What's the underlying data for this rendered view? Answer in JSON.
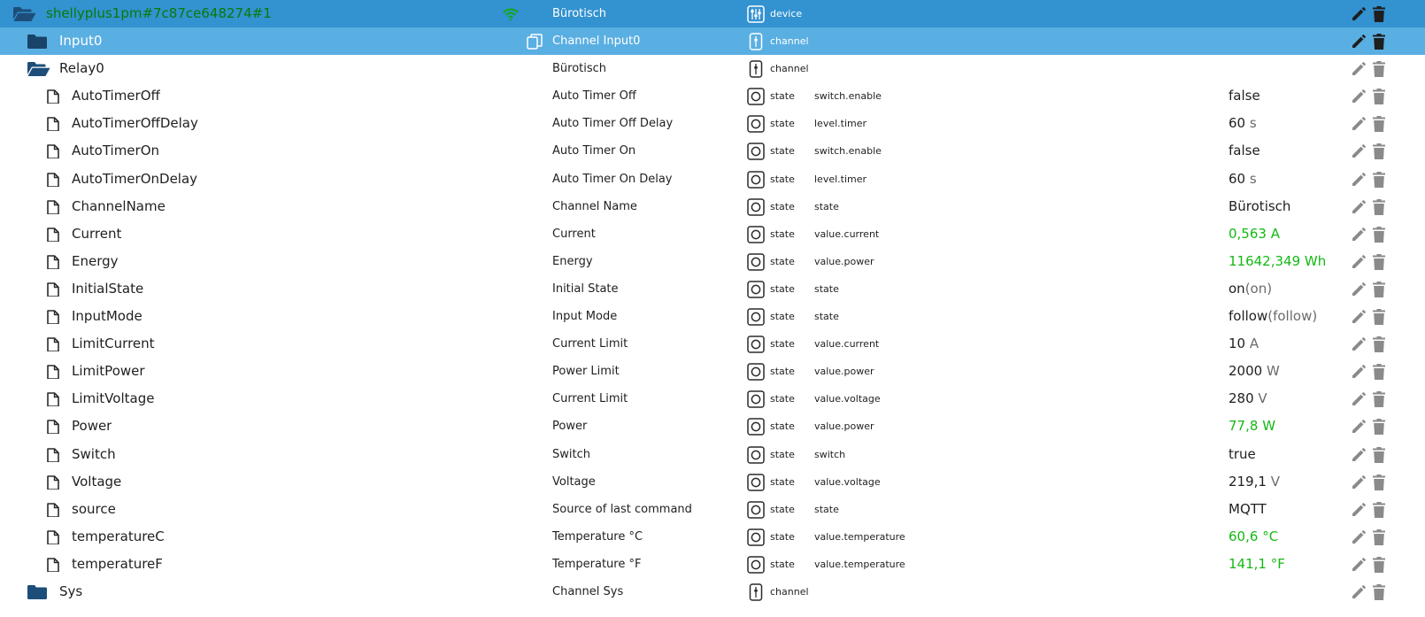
{
  "rows": [
    {
      "name": "shellyplus1pm#7c87ce648274#1",
      "level": 0,
      "icon": "folder-open-icon",
      "label": "Bürotisch",
      "type": "device",
      "role": "",
      "value": "",
      "unit": "",
      "value_extra": "",
      "value_color": "",
      "selected": 1,
      "wifi_icon": "wifi-icon"
    },
    {
      "name": "Input0",
      "level": 1,
      "icon": "folder-icon",
      "label": "Channel Input0",
      "type": "channel",
      "role": "",
      "value": "",
      "unit": "",
      "value_extra": "",
      "value_color": "",
      "selected": 2,
      "copy_icon": "copy-icon"
    },
    {
      "name": "Relay0",
      "level": 1,
      "icon": "folder-open-icon",
      "label": "Bürotisch",
      "type": "channel",
      "role": "",
      "value": "",
      "unit": "",
      "value_extra": "",
      "value_color": "",
      "selected": 0
    },
    {
      "name": "AutoTimerOff",
      "level": 2,
      "icon": "file-icon",
      "label": "Auto Timer Off",
      "type": "state",
      "role": "switch.enable",
      "value": "false",
      "unit": "",
      "value_extra": "",
      "value_color": "",
      "selected": 0
    },
    {
      "name": "AutoTimerOffDelay",
      "level": 2,
      "icon": "file-icon",
      "label": "Auto Timer Off Delay",
      "type": "state",
      "role": "level.timer",
      "value": "60",
      "unit": "s",
      "value_extra": "",
      "value_color": "",
      "selected": 0
    },
    {
      "name": "AutoTimerOn",
      "level": 2,
      "icon": "file-icon",
      "label": "Auto Timer On",
      "type": "state",
      "role": "switch.enable",
      "value": "false",
      "unit": "",
      "value_extra": "",
      "value_color": "",
      "selected": 0
    },
    {
      "name": "AutoTimerOnDelay",
      "level": 2,
      "icon": "file-icon",
      "label": "Auto Timer On Delay",
      "type": "state",
      "role": "level.timer",
      "value": "60",
      "unit": "s",
      "value_extra": "",
      "value_color": "",
      "selected": 0
    },
    {
      "name": "ChannelName",
      "level": 2,
      "icon": "file-icon",
      "label": "Channel Name",
      "type": "state",
      "role": "state",
      "value": "Bürotisch",
      "unit": "",
      "value_extra": "",
      "value_color": "",
      "selected": 0
    },
    {
      "name": "Current",
      "level": 2,
      "icon": "file-icon",
      "label": "Current",
      "type": "state",
      "role": "value.current",
      "value": "0,563",
      "unit": "A",
      "value_extra": "",
      "value_color": "#14b814",
      "selected": 0
    },
    {
      "name": "Energy",
      "level": 2,
      "icon": "file-icon",
      "label": "Energy",
      "type": "state",
      "role": "value.power",
      "value": "11642,349",
      "unit": "Wh",
      "value_extra": "",
      "value_color": "#14b814",
      "selected": 0
    },
    {
      "name": "InitialState",
      "level": 2,
      "icon": "file-icon",
      "label": "Initial State",
      "type": "state",
      "role": "state",
      "value": "on",
      "unit": "",
      "value_extra": "(on)",
      "value_color": "",
      "selected": 0
    },
    {
      "name": "InputMode",
      "level": 2,
      "icon": "file-icon",
      "label": "Input Mode",
      "type": "state",
      "role": "state",
      "value": "follow",
      "unit": "",
      "value_extra": "(follow)",
      "value_color": "",
      "selected": 0
    },
    {
      "name": "LimitCurrent",
      "level": 2,
      "icon": "file-icon",
      "label": "Current Limit",
      "type": "state",
      "role": "value.current",
      "value": "10",
      "unit": "A",
      "value_extra": "",
      "value_color": "",
      "selected": 0
    },
    {
      "name": "LimitPower",
      "level": 2,
      "icon": "file-icon",
      "label": "Power Limit",
      "type": "state",
      "role": "value.power",
      "value": "2000",
      "unit": "W",
      "value_extra": "",
      "value_color": "",
      "selected": 0
    },
    {
      "name": "LimitVoltage",
      "level": 2,
      "icon": "file-icon",
      "label": "Current Limit",
      "type": "state",
      "role": "value.voltage",
      "value": "280",
      "unit": "V",
      "value_extra": "",
      "value_color": "",
      "selected": 0
    },
    {
      "name": "Power",
      "level": 2,
      "icon": "file-icon",
      "label": "Power",
      "type": "state",
      "role": "value.power",
      "value": "77,8",
      "unit": "W",
      "value_extra": "",
      "value_color": "#14b814",
      "selected": 0
    },
    {
      "name": "Switch",
      "level": 2,
      "icon": "file-icon",
      "label": "Switch",
      "type": "state",
      "role": "switch",
      "value": "true",
      "unit": "",
      "value_extra": "",
      "value_color": "",
      "selected": 0
    },
    {
      "name": "Voltage",
      "level": 2,
      "icon": "file-icon",
      "label": "Voltage",
      "type": "state",
      "role": "value.voltage",
      "value": "219,1",
      "unit": "V",
      "value_extra": "",
      "value_color": "",
      "selected": 0
    },
    {
      "name": "source",
      "level": 2,
      "icon": "file-icon",
      "label": "Source of last command",
      "type": "state",
      "role": "state",
      "value": "MQTT",
      "unit": "",
      "value_extra": "",
      "value_color": "",
      "selected": 0
    },
    {
      "name": "temperatureC",
      "level": 2,
      "icon": "file-icon",
      "label": "Temperature °C",
      "type": "state",
      "role": "value.temperature",
      "value": "60,6",
      "unit": "°C",
      "value_extra": "",
      "value_color": "#14b814",
      "selected": 0
    },
    {
      "name": "temperatureF",
      "level": 2,
      "icon": "file-icon",
      "label": "Temperature °F",
      "type": "state",
      "role": "value.temperature",
      "value": "141,1",
      "unit": "°F",
      "value_extra": "",
      "value_color": "#14b814",
      "selected": 0
    },
    {
      "name": "Sys",
      "level": 1,
      "icon": "folder-icon",
      "label": "Channel Sys",
      "type": "channel",
      "role": "",
      "value": "",
      "unit": "",
      "value_extra": "",
      "value_color": "",
      "selected": 0
    }
  ],
  "colors": {
    "selected_row": "#3392d0",
    "selected_row_light": "#5aafe2",
    "folder": "#1d4e7a",
    "value_green": "#14b814",
    "action_icon": "#8a8a8a"
  }
}
